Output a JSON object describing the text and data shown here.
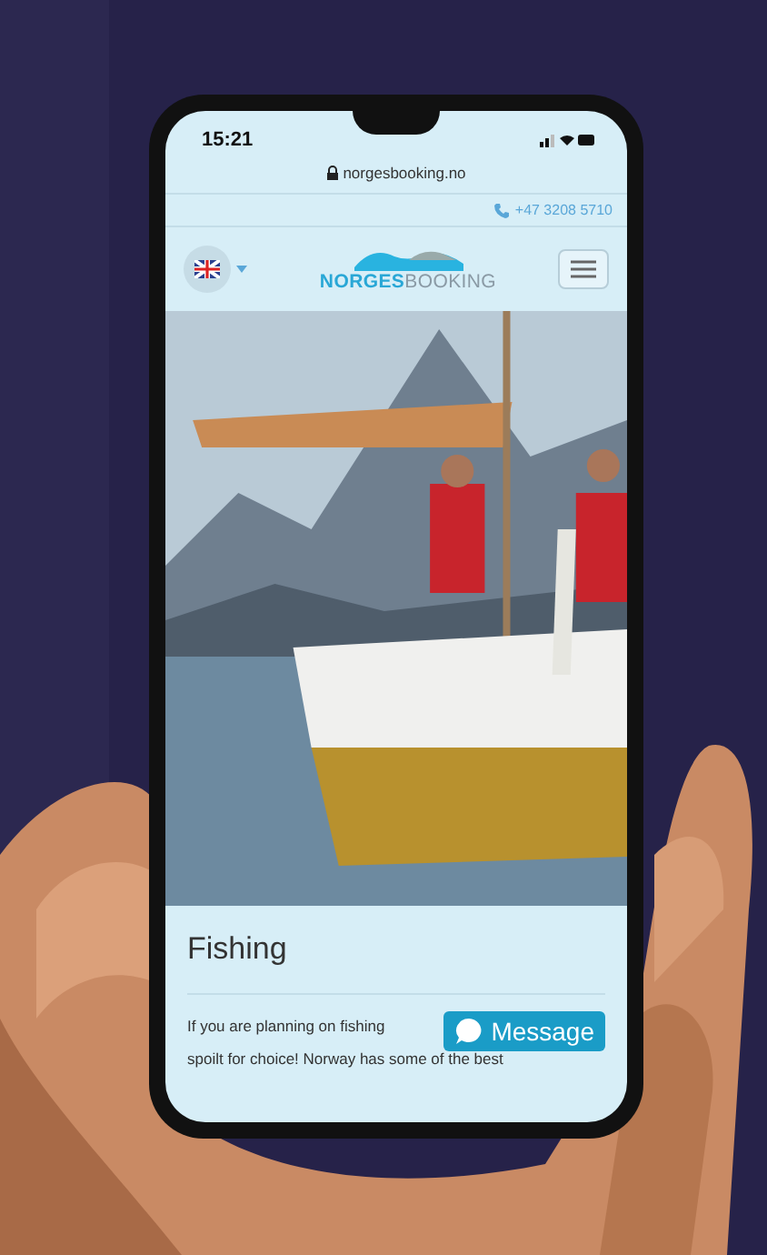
{
  "status_bar": {
    "time": "15:21"
  },
  "address_bar": {
    "url": "norgesbooking.no"
  },
  "top_bar": {
    "phone": "+47 3208 5710"
  },
  "header": {
    "logo": {
      "part_1": "NORGES",
      "part_2": "BOOKING"
    }
  },
  "section": {
    "title": "Fishing",
    "lines": [
      "If you are planning on fishing",
      "spoilt for choice! Norway has some of the best"
    ]
  },
  "chat_button": {
    "label": "Message"
  }
}
